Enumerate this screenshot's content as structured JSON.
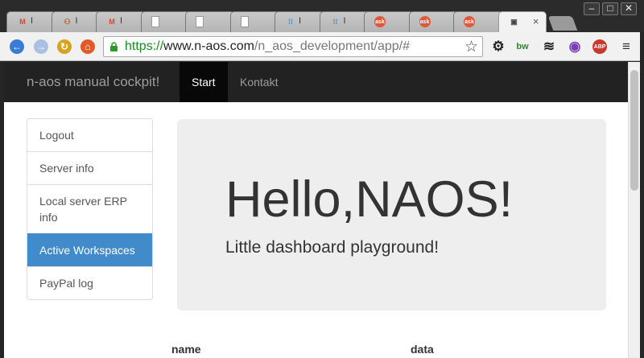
{
  "browser": {
    "tabs": [
      {
        "icon": "gmail-icon",
        "glyph": "M",
        "color": "#d44638",
        "title": "I"
      },
      {
        "icon": "user-icon",
        "glyph": "⚇",
        "color": "#b5532b",
        "title": "I"
      },
      {
        "icon": "gmail-icon",
        "glyph": "M",
        "color": "#d44638",
        "title": "I"
      },
      {
        "icon": "document-icon",
        "glyph": "▯",
        "color": "#ffffff",
        "title": ""
      },
      {
        "icon": "document-icon",
        "glyph": "▯",
        "color": "#ffffff",
        "title": ""
      },
      {
        "icon": "document-icon",
        "glyph": "▯",
        "color": "#ffffff",
        "title": ""
      },
      {
        "icon": "grid-dots-icon",
        "glyph": "⁞⁞",
        "color": "#3a8bd8",
        "title": "I"
      },
      {
        "icon": "grid-dots-icon",
        "glyph": "⁞⁞",
        "color": "#3a8bd8",
        "title": "I"
      },
      {
        "icon": "ask-icon",
        "glyph": "ask",
        "color": "#e0573a",
        "title": ""
      },
      {
        "icon": "ask-icon",
        "glyph": "ask",
        "color": "#e0573a",
        "title": ""
      },
      {
        "icon": "ask-icon",
        "glyph": "ask",
        "color": "#e0573a",
        "title": ""
      },
      {
        "icon": "page-icon",
        "glyph": "▣",
        "color": "#444444",
        "title": ""
      }
    ],
    "close_glyph": "×",
    "window_controls": {
      "minimize": "–",
      "maximize": "□",
      "close": "✕"
    },
    "address": {
      "scheme": "https://",
      "host": "www.n-aos.com",
      "path": "/n_aos_development/app/#"
    },
    "star": "☆",
    "extensions": [
      {
        "name": "settings-extension-icon",
        "glyph": "⚙",
        "color": "#222222"
      },
      {
        "name": "bw-extension-icon",
        "glyph": "bw",
        "color": "#2a8a2a"
      },
      {
        "name": "layers-extension-icon",
        "glyph": "≋",
        "color": "#222222"
      },
      {
        "name": "color-wheel-extension-icon",
        "glyph": "◉",
        "color": "#7a3fb8"
      },
      {
        "name": "adblock-extension-icon",
        "glyph": "ABP",
        "color": "#c8392b"
      },
      {
        "name": "menu-icon",
        "glyph": "≡",
        "color": "#333333"
      }
    ]
  },
  "page": {
    "brand": "n-aos manual cockpit!",
    "nav": [
      {
        "label": "Start",
        "active": true
      },
      {
        "label": "Kontakt",
        "active": false
      }
    ],
    "sidebar": [
      {
        "label": "Logout",
        "active": false
      },
      {
        "label": "Server info",
        "active": false
      },
      {
        "label": "Local server ERP info",
        "active": false
      },
      {
        "label": "Active Workspaces",
        "active": true
      },
      {
        "label": "PayPal log",
        "active": false
      }
    ],
    "jumbotron": {
      "heading": "Hello,NAOS!",
      "lead": "Little dashboard playground!"
    },
    "table": {
      "headers": [
        "name",
        "data"
      ]
    }
  }
}
